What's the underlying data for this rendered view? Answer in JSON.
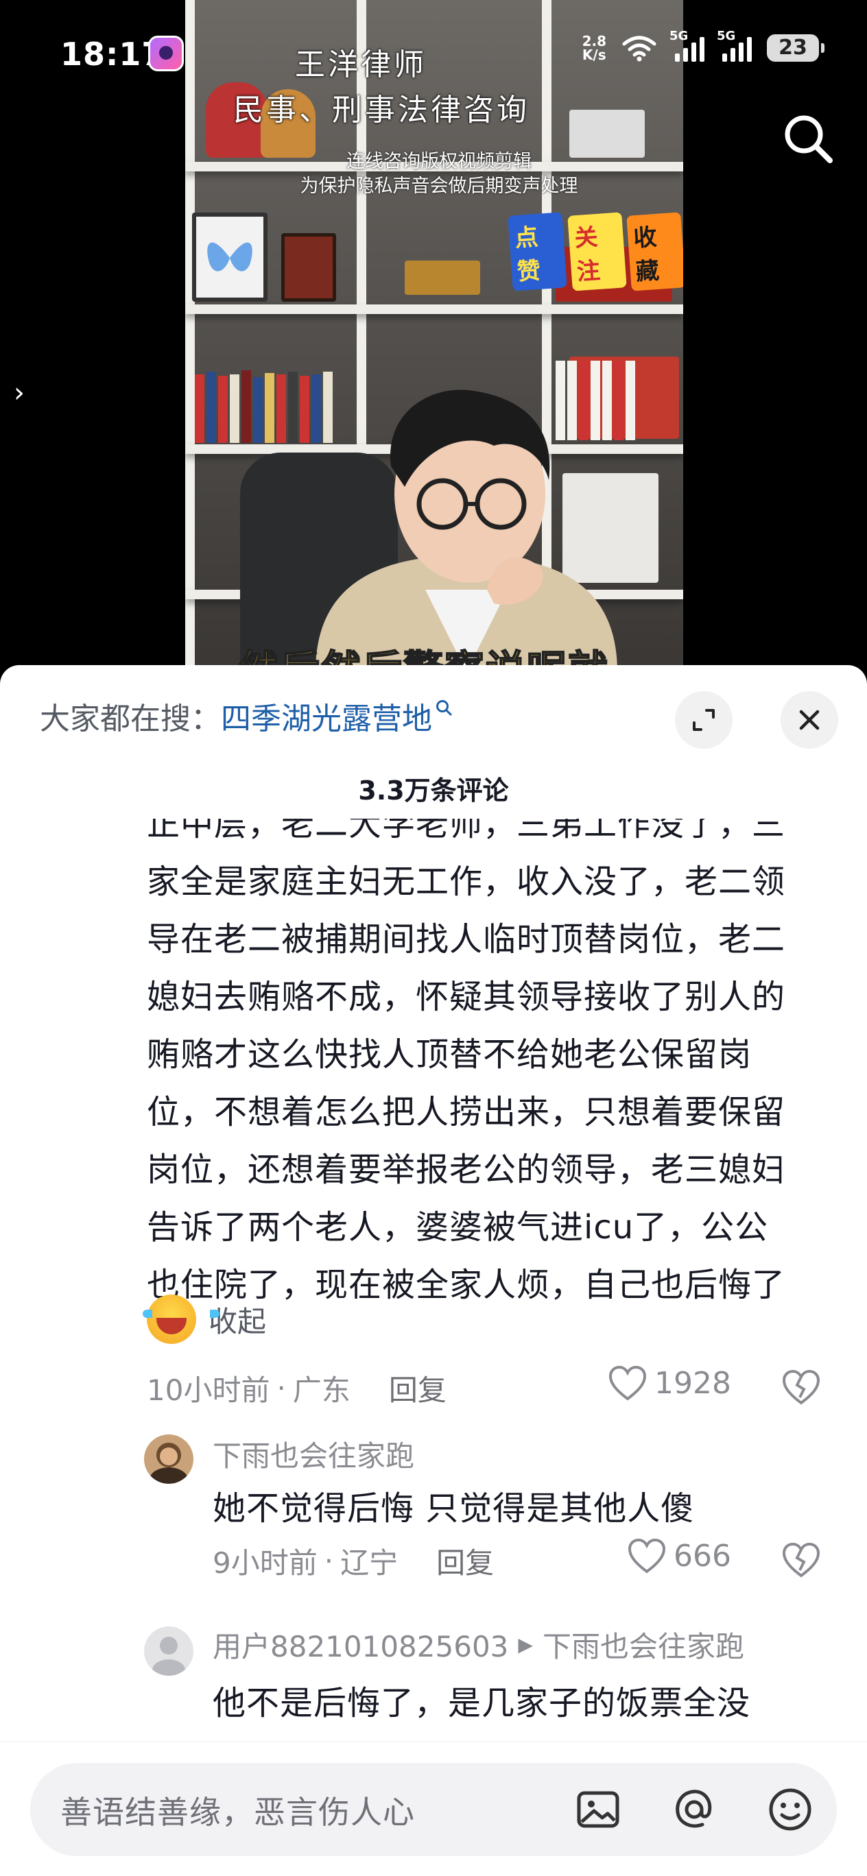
{
  "status_bar": {
    "time": "18:17",
    "net_speed_value": "2.8",
    "net_speed_unit": "K/s",
    "signal1_tag": "5G",
    "signal2_tag": "5G",
    "battery": "23"
  },
  "video": {
    "title": "王洋律师",
    "subtitle": "民事、刑事法律咨询",
    "note_line1": "连线咨询版权视频剪辑",
    "note_line2": "为保护隐私声音会做后期变声处理",
    "stickers": [
      "点赞",
      "关注",
      "收藏"
    ],
    "caption_peek": "然后然后警察说呢就"
  },
  "hot_search": {
    "prefix": "大家都在搜：",
    "keyword": "四季湖光露营地",
    "icon": "search-small-icon"
  },
  "comment_count": "3.3万条评论",
  "main_comment": {
    "lines": [
      "正中层，老二大学老师，三弟工作没了，三",
      "家全是家庭主妇无工作，收入没了，老二领",
      "导在老二被捕期间找人临时顶替岗位，老二",
      "媳妇去贿赂不成，怀疑其领导接收了别人的",
      "贿赂才这么快找人顶替不给她老公保留岗",
      "位，不想着怎么把人捞出来，只想着要保留",
      "岗位，还想着要举报老公的领导，老三媳妇",
      "告诉了两个老人，婆婆被气进icu了，公公",
      "也住院了，现在被全家人烦，自己也后悔了"
    ],
    "collapse_label": "收起",
    "time": "10小时前",
    "location": "广东",
    "reply_label": "回复",
    "likes": "1928"
  },
  "replies": [
    {
      "name": "下雨也会往家跑",
      "text": "她不觉得后悔  只觉得是其他人傻",
      "time": "9小时前",
      "location": "辽宁",
      "reply_label": "回复",
      "likes": "666"
    },
    {
      "name": "用户8821010825603",
      "reply_to": "下雨也会往家跑",
      "text": "他不是后悔了，是几家子的饭票全没"
    }
  ],
  "input_bar": {
    "placeholder": "善语结善缘，恶言伤人心"
  },
  "colors": {
    "keyword_blue": "#1f5fa8",
    "text_primary": "#161823",
    "text_secondary": "#8a8b91"
  }
}
